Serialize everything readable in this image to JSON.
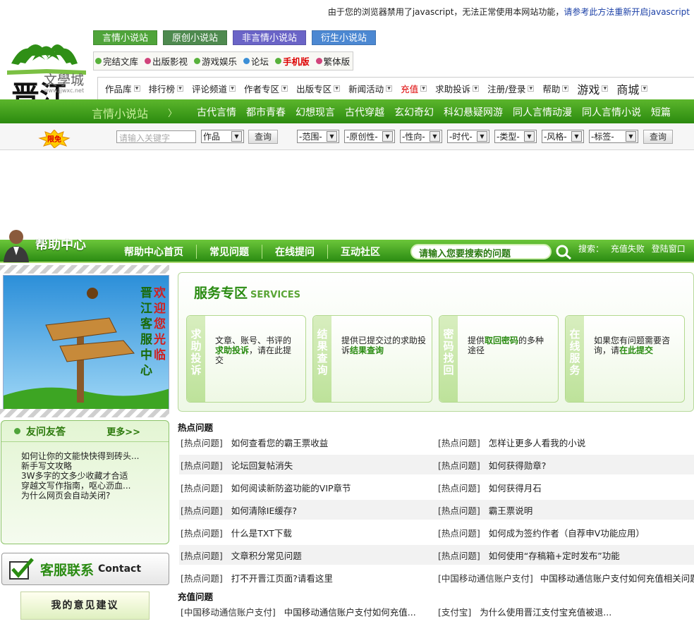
{
  "notice": {
    "text": "由于您的浏览器禁用了javascript，无法正常使用本网站功能，",
    "link": "请参考此方法重新开启javascript"
  },
  "logo": {
    "brand": "文學城",
    "domain": "www.jjwxc.net",
    "seal": "晋江"
  },
  "site_tabs": [
    {
      "label": "言情小说站",
      "color": "#4fa43a"
    },
    {
      "label": "原创小说站",
      "color": "#4e8a4f"
    },
    {
      "label": "非言情小说站",
      "color": "#6a64c7"
    },
    {
      "label": "衍生小说站",
      "color": "#4c88d2"
    }
  ],
  "quick_links": [
    {
      "label": "完结文库",
      "color": "#58b13b"
    },
    {
      "label": "出版影视",
      "color": "#d0447b"
    },
    {
      "label": "游戏娱乐",
      "color": "#58b13b"
    },
    {
      "label": "论坛",
      "color": "#3b8fd6"
    },
    {
      "label": "手机版",
      "color": "#58b13b",
      "highlight": true
    },
    {
      "label": "繁体版",
      "color": "#d0447b"
    }
  ],
  "main_nav": [
    {
      "label": "作品库",
      "big": false,
      "red": false
    },
    {
      "label": "排行榜",
      "big": false,
      "red": false
    },
    {
      "label": "评论频道",
      "big": false,
      "red": false
    },
    {
      "label": "作者专区",
      "big": false,
      "red": false
    },
    {
      "label": "出版专区",
      "big": false,
      "red": false
    },
    {
      "label": "新闻活动",
      "big": false,
      "red": false
    },
    {
      "label": "充值",
      "big": false,
      "red": true
    },
    {
      "label": "求助投诉",
      "big": false,
      "red": false
    },
    {
      "label": "注册/登录",
      "big": false,
      "red": false
    },
    {
      "label": "帮助",
      "big": false,
      "red": false
    },
    {
      "label": "游戏",
      "big": true,
      "red": false
    },
    {
      "label": "商城",
      "big": true,
      "red": false
    }
  ],
  "category_bar": {
    "site_label": "言情小说站",
    "arrow": "〉",
    "categories": [
      "古代言情",
      "都市青春",
      "幻想现言",
      "古代穿越",
      "玄幻奇幻",
      "科幻悬疑网游",
      "同人言情动漫",
      "同人言情小说",
      "短篇"
    ]
  },
  "search": {
    "badge": "限免",
    "placeholder": "请输入关键字",
    "type_value": "作品",
    "button": "查询",
    "filters": [
      "-范围-",
      "-原创性-",
      "-性向-",
      "-时代-",
      "-类型-",
      "-风格-",
      "-标签-"
    ],
    "filter_button": "查询"
  },
  "help_bar": {
    "title": "帮助中心",
    "nav": [
      "帮助中心首页",
      "常见问题",
      "在线提问",
      "互动社区"
    ],
    "search_placeholder": "请输入您要搜索的问题",
    "search_label": "搜索：",
    "hot_links": [
      "充值失败",
      "登陆窗口"
    ]
  },
  "welcome": {
    "col1": "晋江客服中心",
    "col2": "欢迎您光临"
  },
  "faq": {
    "title": "友问友答",
    "more": "更多>>",
    "items": [
      "如何让你的文能快快得到砖头...",
      "新手写文攻略",
      "3W多字的文多少收藏才合适",
      "穿越文写作指南，呕心沥血...",
      "为什么网页会自动关闭?"
    ]
  },
  "contact": {
    "cn": "客服联系",
    "en": "Contact"
  },
  "suggest": "我的意见建议",
  "services": {
    "title": "服务专区",
    "title_en": "SERVICES",
    "cards": [
      {
        "tag": "求助投诉",
        "pre": "文章、账号、书评的",
        "link": "求助投诉",
        "post": "，请在此提交"
      },
      {
        "tag": "结果查询",
        "pre": "提供已提交过的求助投诉",
        "link": "结果查询",
        "post": ""
      },
      {
        "tag": "密码找回",
        "pre": "提供",
        "link": "取回密码",
        "post": "的多种途径"
      },
      {
        "tag": "在线服务",
        "pre": "如果您有问题需要咨询，请",
        "link": "在此提交",
        "post": ""
      }
    ]
  },
  "hot_questions": {
    "title": "热点问题",
    "rows": [
      [
        {
          "tag": "[热点问题]",
          "text": "如何查看您的霸王票收益"
        },
        {
          "tag": "[热点问题]",
          "text": "怎样让更多人看我的小说"
        }
      ],
      [
        {
          "tag": "[热点问题]",
          "text": "论坛回复帖消失"
        },
        {
          "tag": "[热点问题]",
          "text": "如何获得勋章?"
        }
      ],
      [
        {
          "tag": "[热点问题]",
          "text": "如何阅读新防盗功能的VIP章节"
        },
        {
          "tag": "[热点问题]",
          "text": "如何获得月石"
        }
      ],
      [
        {
          "tag": "[热点问题]",
          "text": "如何清除IE缓存?"
        },
        {
          "tag": "[热点问题]",
          "text": "霸王票说明"
        }
      ],
      [
        {
          "tag": "[热点问题]",
          "text": "什么是TXT下载"
        },
        {
          "tag": "[热点问题]",
          "text": "如何成为签约作者（自荐申V功能应用）"
        }
      ],
      [
        {
          "tag": "[热点问题]",
          "text": "文章积分常见问题"
        },
        {
          "tag": "[热点问题]",
          "text": "如何使用“存稿箱+定时发布”功能"
        }
      ],
      [
        {
          "tag": "[热点问题]",
          "text": "打不开晋江页面?请看这里"
        },
        {
          "tag": "[中国移动通信账户支付]",
          "text": "中国移动通信账户支付如何充值相关问题"
        }
      ]
    ]
  },
  "recharge_questions": {
    "title": "充值问题",
    "rows": [
      [
        {
          "tag": "[中国移动通信账户支付]",
          "text": "中国移动通信账户支付如何充值..."
        },
        {
          "tag": "[支付宝]",
          "text": "为什么使用晋江支付宝充值被退..."
        }
      ]
    ]
  }
}
